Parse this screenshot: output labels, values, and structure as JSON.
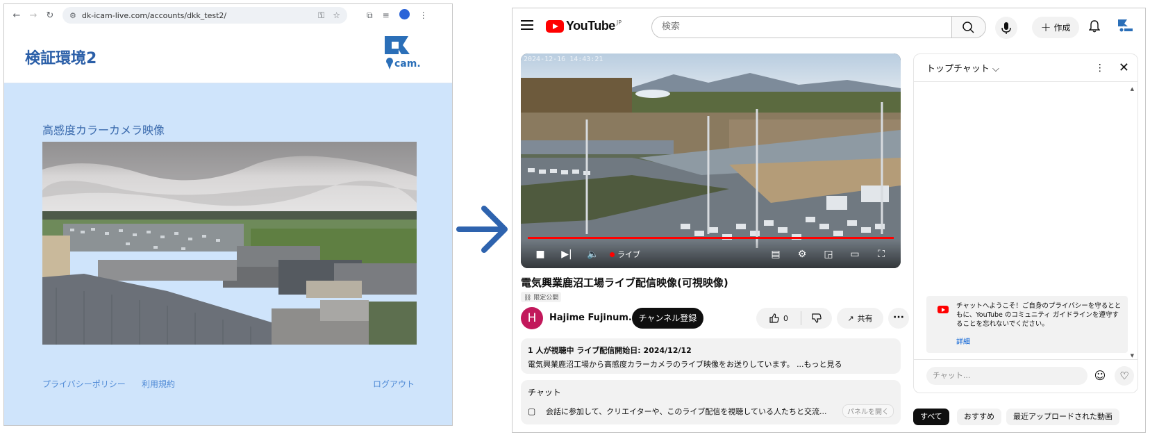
{
  "left_window": {
    "address_bar": {
      "url": "dk-icam-live.com/accounts/dkk_test2/"
    },
    "site_title": "検証環境2",
    "logo_text": "cam.",
    "camera_section_title": "高感度カラーカメラ映像",
    "footer": {
      "privacy": "プライバシーポリシー",
      "terms": "利用規約",
      "logout": "ログアウト"
    }
  },
  "youtube": {
    "logo": {
      "word": "YouTube",
      "region": "JP"
    },
    "search_placeholder": "検索",
    "create_label": "作成",
    "player": {
      "timestamp": "2024-12-16 14:43:21",
      "live_label": "ライブ"
    },
    "video_title": "電気興業鹿沼工場ライブ配信映像(可視映像)",
    "visibility_badge": "限定公開",
    "channel": {
      "avatar_letter": "H",
      "name": "Hajime Fujinum..."
    },
    "subscribe_label": "チャンネル登録",
    "like_count": "0",
    "share_label": "共有",
    "description": {
      "meta": "1 人が視聴中  ライブ配信開始日: 2024/12/12",
      "text": "電気興業鹿沼工場から高感度カラーカメラのライブ映像をお送りしています。 ...もっと見る"
    },
    "chat_box": {
      "title": "チャット",
      "line": "会話に参加して、クリエイターや、このライブ配信を視聴している人たちと交流...",
      "open_panel": "パネルを開く"
    },
    "chat_panel": {
      "title": "トップチャット",
      "welcome": "チャットへようこそ！ご自身のプライバシーを守るとともに、YouTube のコミュニティ ガイドラインを遵守することを忘れないでください。",
      "details": "詳細",
      "input_placeholder": "チャット..."
    },
    "chips": [
      "すべて",
      "おすすめ",
      "最近アップロードされた動画"
    ]
  },
  "colors": {
    "left_background": "#cfe4fb",
    "site_title": "#2b5fa8",
    "arrow": "#2e63ae",
    "youtube_red": "#ff0000",
    "link_blue": "#065fd4"
  },
  "icons": [
    "back-icon",
    "forward-icon",
    "reload-icon",
    "site-settings-icon",
    "password-key-icon",
    "star-icon",
    "extensions-icon",
    "media-icon",
    "profile-icon",
    "chrome-menu-icon",
    "menu-icon",
    "search-icon",
    "mic-icon",
    "plus-icon",
    "bell-icon",
    "stop-icon",
    "next-icon",
    "volume-icon",
    "subtitles-icon",
    "settings-icon",
    "miniplayer-icon",
    "theater-icon",
    "fullscreen-icon",
    "thumbs-up-icon",
    "thumbs-down-icon",
    "share-icon",
    "more-icon",
    "chat-icon",
    "close-icon",
    "emoji-icon",
    "heart-icon",
    "arrow-right-icon"
  ]
}
